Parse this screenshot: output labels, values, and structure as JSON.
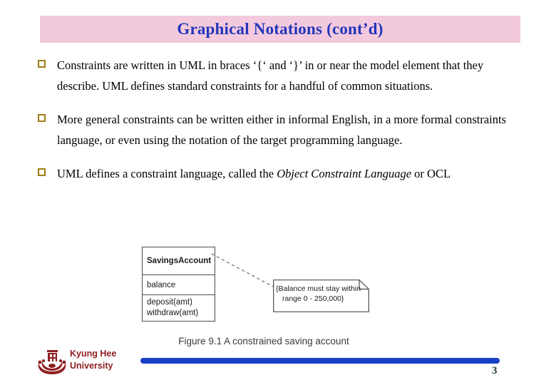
{
  "slide": {
    "title": "Graphical Notations (cont’d)",
    "page_number": "3",
    "colors": {
      "title_banner_bg": "#f3cadd",
      "title_text": "#2436bb",
      "bullet_marker": "#9d7d14",
      "footer_bar": "#1740c4",
      "university_text": "#8f1f20",
      "page_number": "#1f3a22"
    }
  },
  "bullets": [
    {
      "marker": "hollow-square-bullet",
      "text_part1": "Constraints are written in UML in braces ‘{‘ and ‘}’ in or near the model element that they describe. UML defines standard constraints for a handful of common situations."
    },
    {
      "marker": "hollow-square-bullet",
      "text_part1": "More general constraints can be written either in informal English, in a more formal constraints language, or even using the notation of the target programming language."
    },
    {
      "marker": "hollow-square-bullet",
      "text_part1": "UML defines a constraint language, called the ",
      "italic": "Object Constraint Language",
      "text_part2": " or OCL"
    }
  ],
  "figure": {
    "caption": "Figure 9.1 A constrained saving account",
    "class_box": {
      "name": "SavingsAccount",
      "attributes": [
        "balance"
      ],
      "operations": [
        "deposit(amt)",
        "withdraw(amt)"
      ]
    },
    "note": {
      "line1": "{Balance must stay within",
      "line2": "range 0 - 250,000}"
    }
  },
  "footer": {
    "university_line1": "Kyung Hee",
    "university_line2": "University",
    "logo_icon": "kyung-hee-crest-icon"
  }
}
